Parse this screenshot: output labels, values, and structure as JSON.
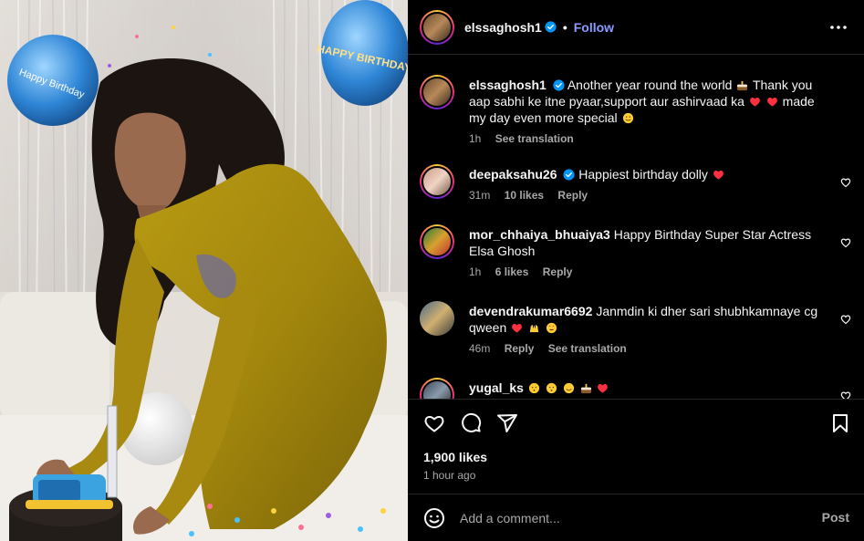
{
  "post": {
    "author": "elssaghosh1",
    "follow_label": "Follow",
    "separator": "•",
    "likes": "1,900 likes",
    "time_ago": "1 hour ago",
    "media": {
      "balloon_left_text": "Happy Birthday",
      "balloon_right_text": "HAPPY BIRTHDAY"
    }
  },
  "caption": {
    "username": "elssaghosh1",
    "text_1": "Another year round the world",
    "text_2": "Thank you aap sabhi ke itne pyaar,support aur ashirvaad ka",
    "text_3": "made my day even more special",
    "time": "1h",
    "see_translation": "See translation"
  },
  "comments": [
    {
      "username": "deepaksahu26",
      "text": "Happiest birthday dolly",
      "time": "31m",
      "likes": "10 likes",
      "reply": "Reply"
    },
    {
      "username": "mor_chhaiya_bhuaiya3",
      "text": "Happy Birthday Super Star Actress Elsa Ghosh",
      "time": "1h",
      "likes": "6 likes",
      "reply": "Reply"
    },
    {
      "username": "devendrakumar6692",
      "text": "Janmdin ki dher sari shubhkamnaye cg qween",
      "time": "46m",
      "reply": "Reply",
      "see_translation": "See translation"
    },
    {
      "username": "yugal_ks",
      "text": ""
    }
  ],
  "composer": {
    "placeholder": "Add a comment...",
    "post_label": "Post"
  },
  "icons": {
    "verified": "verified-badge-icon",
    "more": "more-options-icon",
    "like": "heart-icon",
    "comment": "comment-icon",
    "share": "share-icon",
    "save": "bookmark-icon",
    "emoji": "emoji-icon"
  },
  "colors": {
    "background": "#000000",
    "accent_link": "#8a9cff",
    "verified": "#0095f6",
    "heart_red": "#ff3040",
    "muted": "#a8a8a8"
  }
}
